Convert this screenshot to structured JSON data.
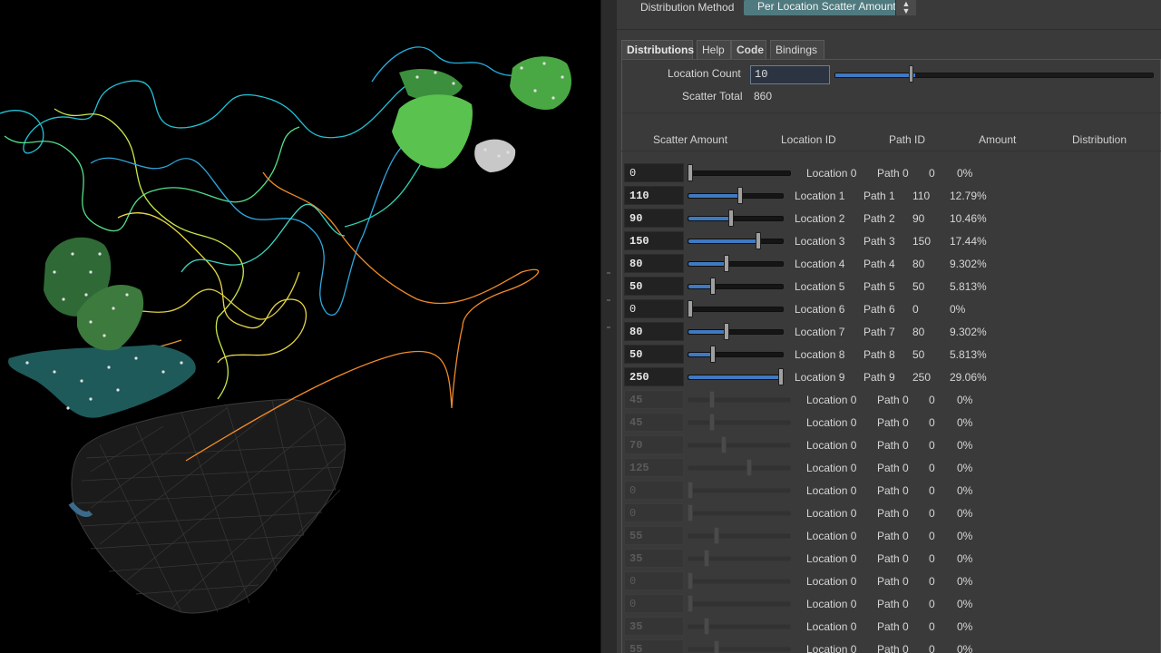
{
  "panel": {
    "distribution_method_label": "Distribution Method",
    "distribution_method_value": "Per Location Scatter Amount",
    "tabs": [
      {
        "label": "Distributions"
      },
      {
        "label": "Help"
      },
      {
        "label": "Code"
      },
      {
        "label": "Bindings"
      }
    ],
    "location_count_label": "Location Count",
    "location_count_value": "10",
    "location_count_slider_fraction": 0.25,
    "scatter_total_label": "Scatter Total",
    "scatter_total_value": "860",
    "columns": [
      "Scatter Amount",
      "Location ID",
      "Path ID",
      "Amount",
      "Distribution"
    ]
  },
  "rows": [
    {
      "scatter": "0",
      "slider": 0.0,
      "location": "Location 0",
      "path": "Path 0",
      "amount": "0",
      "dist": "0%",
      "enabled": true
    },
    {
      "scatter": "110",
      "slider": 0.55,
      "location": "Location 1",
      "path": "Path 1",
      "amount": "110",
      "dist": "12.79%",
      "enabled": true
    },
    {
      "scatter": "90",
      "slider": 0.45,
      "location": "Location 2",
      "path": "Path 2",
      "amount": "90",
      "dist": "10.46%",
      "enabled": true
    },
    {
      "scatter": "150",
      "slider": 0.75,
      "location": "Location 3",
      "path": "Path 3",
      "amount": "150",
      "dist": "17.44%",
      "enabled": true
    },
    {
      "scatter": "80",
      "slider": 0.4,
      "location": "Location 4",
      "path": "Path 4",
      "amount": "80",
      "dist": "9.302%",
      "enabled": true
    },
    {
      "scatter": "50",
      "slider": 0.25,
      "location": "Location 5",
      "path": "Path 5",
      "amount": "50",
      "dist": "5.813%",
      "enabled": true
    },
    {
      "scatter": "0",
      "slider": 0.0,
      "location": "Location 6",
      "path": "Path 6",
      "amount": "0",
      "dist": "0%",
      "enabled": true
    },
    {
      "scatter": "80",
      "slider": 0.4,
      "location": "Location 7",
      "path": "Path 7",
      "amount": "80",
      "dist": "9.302%",
      "enabled": true
    },
    {
      "scatter": "50",
      "slider": 0.25,
      "location": "Location 8",
      "path": "Path 8",
      "amount": "50",
      "dist": "5.813%",
      "enabled": true
    },
    {
      "scatter": "250",
      "slider": 1.0,
      "location": "Location 9",
      "path": "Path 9",
      "amount": "250",
      "dist": "29.06%",
      "enabled": true
    },
    {
      "scatter": "45",
      "slider": 0.22,
      "location": "Location 0",
      "path": "Path 0",
      "amount": "0",
      "dist": "0%",
      "enabled": false
    },
    {
      "scatter": "45",
      "slider": 0.22,
      "location": "Location 0",
      "path": "Path 0",
      "amount": "0",
      "dist": "0%",
      "enabled": false
    },
    {
      "scatter": "70",
      "slider": 0.34,
      "location": "Location 0",
      "path": "Path 0",
      "amount": "0",
      "dist": "0%",
      "enabled": false
    },
    {
      "scatter": "125",
      "slider": 0.6,
      "location": "Location 0",
      "path": "Path 0",
      "amount": "0",
      "dist": "0%",
      "enabled": false
    },
    {
      "scatter": "0",
      "slider": 0.0,
      "location": "Location 0",
      "path": "Path 0",
      "amount": "0",
      "dist": "0%",
      "enabled": false
    },
    {
      "scatter": "0",
      "slider": 0.0,
      "location": "Location 0",
      "path": "Path 0",
      "amount": "0",
      "dist": "0%",
      "enabled": false
    },
    {
      "scatter": "55",
      "slider": 0.27,
      "location": "Location 0",
      "path": "Path 0",
      "amount": "0",
      "dist": "0%",
      "enabled": false
    },
    {
      "scatter": "35",
      "slider": 0.17,
      "location": "Location 0",
      "path": "Path 0",
      "amount": "0",
      "dist": "0%",
      "enabled": false
    },
    {
      "scatter": "0",
      "slider": 0.0,
      "location": "Location 0",
      "path": "Path 0",
      "amount": "0",
      "dist": "0%",
      "enabled": false
    },
    {
      "scatter": "0",
      "slider": 0.0,
      "location": "Location 0",
      "path": "Path 0",
      "amount": "0",
      "dist": "0%",
      "enabled": false
    },
    {
      "scatter": "35",
      "slider": 0.17,
      "location": "Location 0",
      "path": "Path 0",
      "amount": "0",
      "dist": "0%",
      "enabled": false
    },
    {
      "scatter": "55",
      "slider": 0.27,
      "location": "Location 0",
      "path": "Path 0",
      "amount": "0",
      "dist": "0%",
      "enabled": false
    }
  ],
  "colors": {
    "accent": "#3f79c2",
    "select": "#4f7a7f",
    "panel_bg": "#3a3a3a",
    "viewport_bg": "#000000"
  }
}
